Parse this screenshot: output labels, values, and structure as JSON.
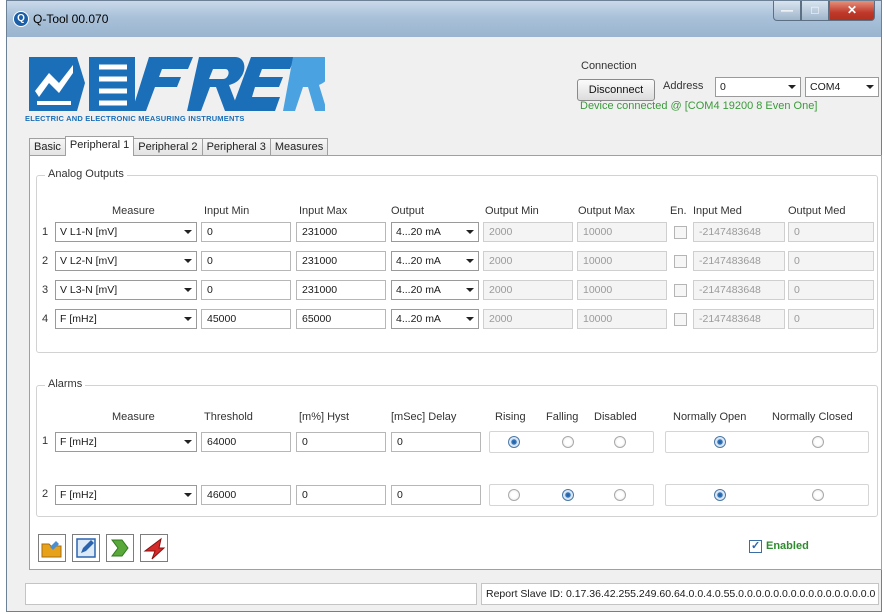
{
  "window": {
    "title": "Q-Tool 00.070",
    "app_icon": "qtool-icon"
  },
  "logo": {
    "brand": "FRER",
    "tagline": "ELECTRIC AND ELECTRONIC MEASURING INSTRUMENTS",
    "colors": {
      "primary": "#1a6fb8",
      "light": "#4aa3e0"
    }
  },
  "connection": {
    "legend": "Connection",
    "disconnect_label": "Disconnect",
    "address_label": "Address",
    "address_value": "0",
    "port_value": "COM4",
    "status": "Device connected @ [COM4 19200 8 Even One]",
    "status_color": "#3a9a3a"
  },
  "tabs": [
    {
      "label": "Basic",
      "active": false
    },
    {
      "label": "Peripheral 1",
      "active": true
    },
    {
      "label": "Peripheral 2",
      "active": false
    },
    {
      "label": "Peripheral 3",
      "active": false
    },
    {
      "label": "Measures",
      "active": false
    }
  ],
  "analog_outputs": {
    "title": "Analog Outputs",
    "headers": {
      "measure": "Measure",
      "input_min": "Input Min",
      "input_max": "Input Max",
      "output": "Output",
      "output_min": "Output Min",
      "output_max": "Output Max",
      "en": "En.",
      "input_med": "Input Med",
      "output_med": "Output Med"
    },
    "rows": [
      {
        "num": "1",
        "measure": "V L1-N [mV]",
        "input_min": "0",
        "input_max": "231000",
        "output": "4...20 mA",
        "output_min": "2000",
        "output_max": "10000",
        "en": false,
        "input_med": "-2147483648",
        "output_med": "0"
      },
      {
        "num": "2",
        "measure": "V L2-N [mV]",
        "input_min": "0",
        "input_max": "231000",
        "output": "4...20 mA",
        "output_min": "2000",
        "output_max": "10000",
        "en": false,
        "input_med": "-2147483648",
        "output_med": "0"
      },
      {
        "num": "3",
        "measure": "V L3-N [mV]",
        "input_min": "0",
        "input_max": "231000",
        "output": "4...20 mA",
        "output_min": "2000",
        "output_max": "10000",
        "en": false,
        "input_med": "-2147483648",
        "output_med": "0"
      },
      {
        "num": "4",
        "measure": "F [mHz]",
        "input_min": "45000",
        "input_max": "65000",
        "output": "4...20 mA",
        "output_min": "2000",
        "output_max": "10000",
        "en": false,
        "input_med": "-2147483648",
        "output_med": "0"
      }
    ]
  },
  "alarms": {
    "title": "Alarms",
    "headers": {
      "measure": "Measure",
      "threshold": "Threshold",
      "hyst": "[m%] Hyst",
      "delay": "[mSec] Delay",
      "rising": "Rising",
      "falling": "Falling",
      "disabled": "Disabled",
      "normally_open": "Normally Open",
      "normally_closed": "Normally Closed"
    },
    "rows": [
      {
        "num": "1",
        "measure": "F [mHz]",
        "threshold": "64000",
        "hyst": "0",
        "delay": "0",
        "mode": "rising",
        "contact": "normally_open"
      },
      {
        "num": "2",
        "measure": "F [mHz]",
        "threshold": "46000",
        "hyst": "0",
        "delay": "0",
        "mode": "falling",
        "contact": "normally_open"
      }
    ]
  },
  "toolbar": {
    "buttons": [
      {
        "name": "open-folder-icon",
        "color": "#e8a21a"
      },
      {
        "name": "edit-document-icon",
        "color": "#2a64b0"
      },
      {
        "name": "green-arrow-icon",
        "color": "#58a83a"
      },
      {
        "name": "red-arrow-icon",
        "color": "#d42a2a"
      }
    ]
  },
  "enabled": {
    "label": "Enabled",
    "checked": true,
    "color": "#2e8b2e"
  },
  "status_bar": {
    "left": "",
    "right": "Report Slave ID: 0.17.36.42.255.249.60.64.0.0.4.0.55.0.0.0.0.0.0.0.0.0.0.0.0.0.0.0.0"
  }
}
